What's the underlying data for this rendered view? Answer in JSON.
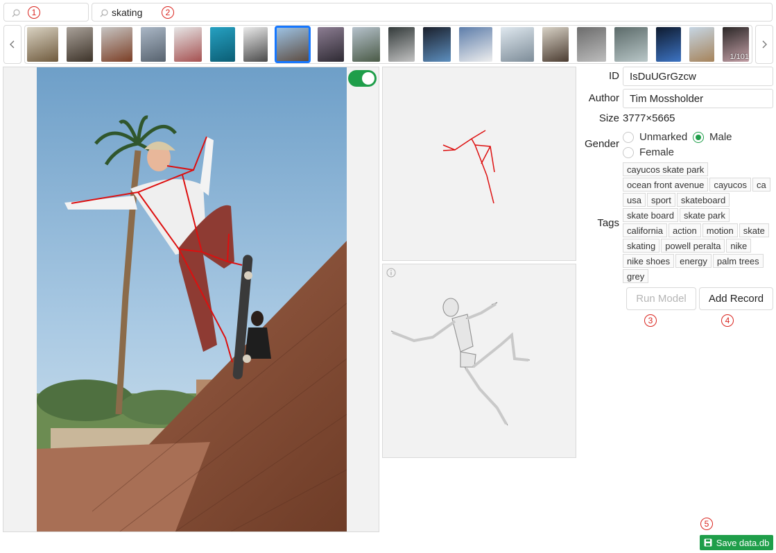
{
  "search": {
    "left_value": "",
    "query": "skating"
  },
  "markers": [
    "1",
    "2",
    "3",
    "4",
    "5"
  ],
  "thumbnails": {
    "counter": "1/101",
    "items": [
      {
        "c1": "#d9d2c2",
        "c2": "#6f5a3d"
      },
      {
        "c1": "#a9a199",
        "c2": "#3d3329"
      },
      {
        "c1": "#c7c5c3",
        "c2": "#7b3e25"
      },
      {
        "c1": "#aab7c6",
        "c2": "#57626e"
      },
      {
        "c1": "#e6e6e6",
        "c2": "#a55050"
      },
      {
        "c1": "#26a1c2",
        "c2": "#0b5d74"
      },
      {
        "c1": "#eaeaea",
        "c2": "#4a4a4a"
      },
      {
        "c1": "#9ec4e6",
        "c2": "#5c4a3e"
      },
      {
        "c1": "#8c7d92",
        "c2": "#2e2a33"
      },
      {
        "c1": "#b6c2cc",
        "c2": "#4a5a46"
      },
      {
        "c1": "#333a3a",
        "c2": "#c2c2c2"
      },
      {
        "c1": "#1a1f2b",
        "c2": "#5d8fbf"
      },
      {
        "c1": "#5d7daa",
        "c2": "#eeeeee"
      },
      {
        "c1": "#dfe8ef",
        "c2": "#7d8c98"
      },
      {
        "c1": "#d8d2c6",
        "c2": "#4b3c31"
      },
      {
        "c1": "#6c6c6c",
        "c2": "#bdbdbd"
      },
      {
        "c1": "#5b6a69",
        "c2": "#b9c7c8"
      },
      {
        "c1": "#0e1a2e",
        "c2": "#3d74c4"
      },
      {
        "c1": "#c6d6e4",
        "c2": "#a6835a"
      },
      {
        "c1": "#2a2626",
        "c2": "#c6a2a9"
      }
    ]
  },
  "record": {
    "id_label": "ID",
    "id_value": "IsDuUGrGzcw",
    "author_label": "Author",
    "author_value": "Tim Mossholder",
    "size_label": "Size",
    "size_value": "3777×5665",
    "gender_label": "Gender",
    "gender_options": [
      "Unmarked",
      "Male",
      "Female"
    ],
    "gender_selected": "Male",
    "tags_label": "Tags",
    "tags": [
      [
        "cayucos skate park"
      ],
      [
        "ocean front avenue",
        "cayucos",
        "ca"
      ],
      [
        "usa",
        "sport",
        "skateboard"
      ],
      [
        "skate board",
        "skate park"
      ],
      [
        "california",
        "action",
        "motion",
        "skate"
      ],
      [
        "skating",
        "powell peralta",
        "nike"
      ],
      [
        "nike shoes",
        "energy",
        "palm trees"
      ],
      [
        "grey"
      ]
    ]
  },
  "buttons": {
    "run_model": "Run Model",
    "add_record": "Add Record",
    "save": "Save data.db"
  },
  "toggle_on": true,
  "colors": {
    "accent": "#1f9e4a",
    "selection": "#1677ff",
    "marker": "#d9221c",
    "pose": "#dd0f0f"
  }
}
